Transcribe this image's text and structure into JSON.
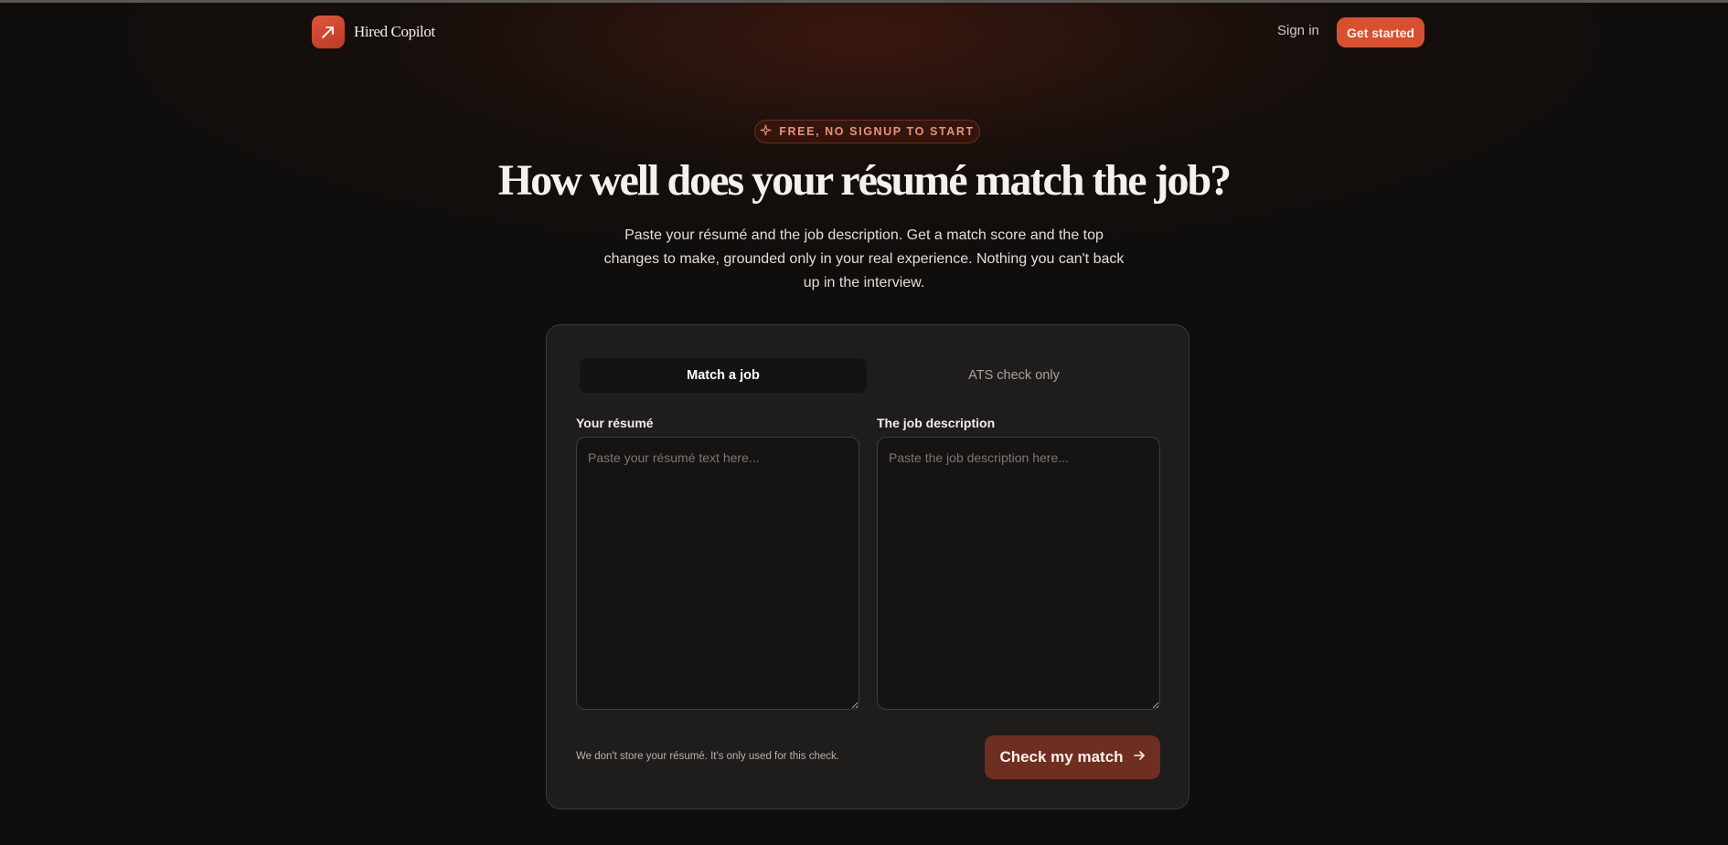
{
  "header": {
    "brand": "Hired Copilot",
    "sign_in": "Sign in",
    "get_started": "Get started"
  },
  "hero": {
    "badge": "FREE, NO SIGNUP TO START",
    "title": "How well does your résumé match the job?",
    "subtitle": "Paste your résumé and the job description. Get a match score and the top changes to make, grounded only in your real experience. Nothing you can't back up in the interview."
  },
  "card": {
    "tabs": [
      {
        "label": "Match a job",
        "active": true
      },
      {
        "label": "ATS check only",
        "active": false
      }
    ],
    "resume": {
      "label": "Your résumé",
      "placeholder": "Paste your résumé text here...",
      "value": ""
    },
    "job": {
      "label": "The job description",
      "placeholder": "Paste the job description here...",
      "value": ""
    },
    "privacy_note": "We don't store your résumé. It's only used for this check.",
    "submit": "Check my match"
  },
  "colors": {
    "accent": "#d9502f",
    "submit_bg": "#6e2e21",
    "background": "#0f0e0c",
    "card_bg": "#1e1d1b"
  },
  "icons": {
    "logo": "arrow-up-right-icon",
    "badge": "sparkle-icon",
    "submit": "arrow-right-icon"
  }
}
